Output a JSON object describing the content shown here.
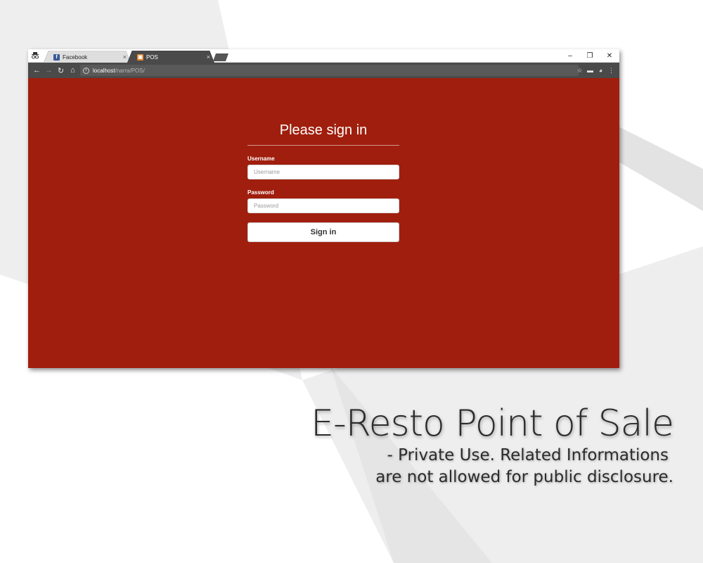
{
  "browser": {
    "tabs": [
      {
        "title": "Facebook",
        "favicon": "facebook-favicon"
      },
      {
        "title": "POS",
        "favicon": "pos-favicon"
      }
    ],
    "tab_close_glyph": "×",
    "window_controls": {
      "minimize": "–",
      "restore": "❐",
      "close": "✕"
    },
    "address": {
      "host": "localhost",
      "path": "/narra/POS/"
    }
  },
  "login": {
    "heading": "Please sign in",
    "username_label": "Username",
    "username_placeholder": "Username",
    "password_label": "Password",
    "password_placeholder": "Password",
    "submit_label": "Sign in"
  },
  "caption": {
    "title": "E-Resto Point of Sale",
    "line1": "- Private Use. Related Informations",
    "line2": "are not allowed for public disclosure."
  },
  "colors": {
    "page_background": "#a01e0d",
    "backdrop": "#efeeef",
    "deco_white": "#ffffff",
    "toolbar": "#4a4a4a"
  }
}
